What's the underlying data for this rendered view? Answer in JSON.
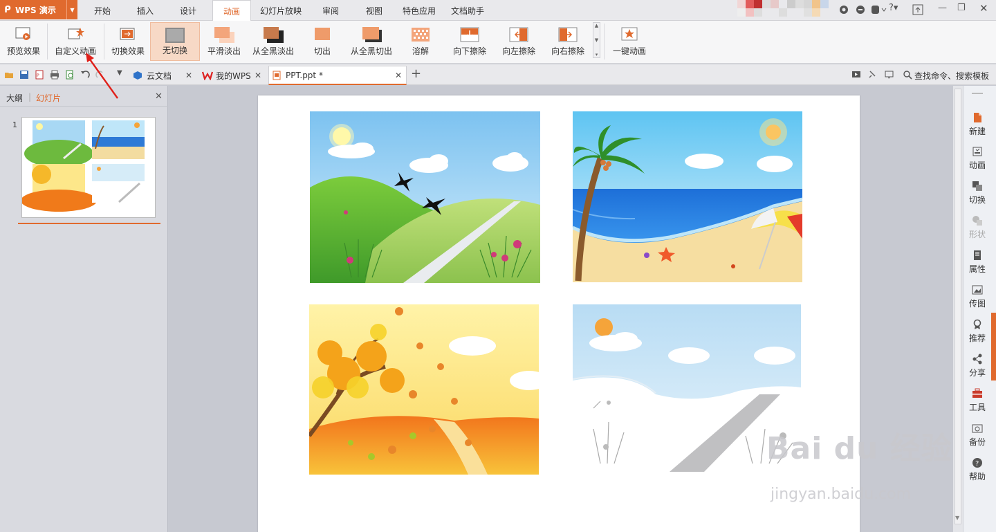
{
  "app": {
    "logo_text": "WPS 演示",
    "brand_color": "#e06a2e"
  },
  "menubar": {
    "items": [
      "开始",
      "插入",
      "设计",
      "动画",
      "幻灯片放映",
      "审阅",
      "视图",
      "特色应用",
      "文档助手"
    ],
    "active": "动画"
  },
  "ribbon": {
    "buttons": [
      "预览效果",
      "自定义动画",
      "切换效果",
      "无切换",
      "平滑淡出",
      "从全黑淡出",
      "切出",
      "从全黑切出",
      "溶解",
      "向下擦除",
      "向左擦除",
      "向右擦除",
      "一键动画"
    ],
    "selected": "无切换"
  },
  "tabs": {
    "items": [
      {
        "label": "云文档"
      },
      {
        "label": "我的WPS"
      },
      {
        "label": "PPT.ppt *"
      }
    ],
    "active": "PPT.ppt *",
    "search_label": "查找命令、搜索模板"
  },
  "left_panel": {
    "tab_outline": "大纲",
    "tab_slides": "幻灯片",
    "slide_number": "1"
  },
  "right_sidebar": {
    "items": [
      {
        "label": "新建",
        "icon": "new-doc-icon"
      },
      {
        "label": "动画",
        "icon": "animation-icon"
      },
      {
        "label": "切换",
        "icon": "transition-icon"
      },
      {
        "label": "形状",
        "icon": "shape-icon",
        "disabled": true
      },
      {
        "label": "属性",
        "icon": "properties-icon"
      },
      {
        "label": "传图",
        "icon": "upload-image-icon"
      },
      {
        "label": "推荐",
        "icon": "recommend-icon"
      },
      {
        "label": "分享",
        "icon": "share-icon"
      },
      {
        "label": "工具",
        "icon": "toolbox-icon"
      },
      {
        "label": "备份",
        "icon": "backup-icon"
      },
      {
        "label": "帮助",
        "icon": "help-icon"
      }
    ]
  },
  "slide": {
    "images": [
      "spring-landscape",
      "summer-beach",
      "autumn-maple",
      "winter-snow"
    ]
  },
  "watermark": {
    "text": "Bai du 经验",
    "url": "jingyan.baidu.com"
  }
}
